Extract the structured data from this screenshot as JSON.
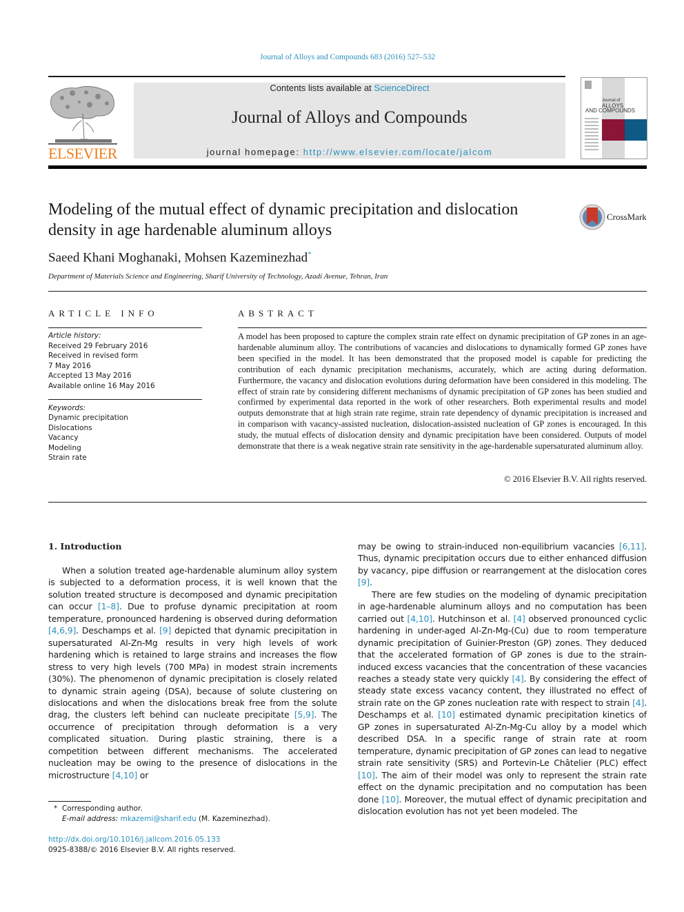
{
  "header": {
    "citation": "Journal of Alloys and Compounds 683 (2016) 527–532",
    "contents_prefix": "Contents lists available at ",
    "contents_link": "ScienceDirect",
    "journal_name": "Journal of Alloys and Compounds",
    "homepage_prefix": "journal homepage: ",
    "homepage_link": "http://www.elsevier.com/locate/jalcom",
    "publisher_logo_text": "ELSEVIER",
    "cover": {
      "line1": "Journal of",
      "line2": "ALLOYS",
      "line3": "AND COMPOUNDS",
      "accent_red": "#8a1537",
      "accent_blue": "#0d5a86"
    }
  },
  "article": {
    "title": "Modeling of the mutual effect of dynamic precipitation and dislocation density in age hardenable aluminum alloys",
    "authors": "Saeed Khani Moghanaki, Mohsen Kazeminezhad",
    "author_mark": "*",
    "affiliation": "Department of Materials Science and Engineering, Sharif University of Technology, Azadi Avenue, Tehran, Iran",
    "crossmark_label": "CrossMark"
  },
  "article_info": {
    "heading": "ARTICLE INFO",
    "history_label": "Article history:",
    "history": [
      "Received 29 February 2016",
      "Received in revised form",
      "7 May 2016",
      "Accepted 13 May 2016",
      "Available online 16 May 2016"
    ],
    "keywords_label": "Keywords:",
    "keywords": [
      "Dynamic precipitation",
      "Dislocations",
      "Vacancy",
      "Modeling",
      "Strain rate"
    ]
  },
  "abstract": {
    "heading": "ABSTRACT",
    "text": "A model has been proposed to capture the complex strain rate effect on dynamic precipitation of GP zones in an age-hardenable aluminum alloy. The contributions of vacancies and dislocations to dynamically formed GP zones have been specified in the model. It has been demonstrated that the proposed model is capable for predicting the contribution of each dynamic precipitation mechanisms, accurately, which are acting during deformation. Furthermore, the vacancy and dislocation evolutions during deformation have been considered in this modeling. The effect of strain rate by considering different mechanisms of dynamic precipitation of GP zones has been studied and confirmed by experimental data reported in the work of other researchers. Both experimental results and model outputs demonstrate that at high strain rate regime, strain rate dependency of dynamic precipitation is increased and in comparison with vacancy-assisted nucleation, dislocation-assisted nucleation of GP zones is encouraged. In this study, the mutual effects of dislocation density and dynamic precipitation have been considered. Outputs of model demonstrate that there is a weak negative strain rate sensitivity in the age-hardenable supersaturated aluminum alloy.",
    "copyright": "© 2016 Elsevier B.V. All rights reserved."
  },
  "body": {
    "section_heading": "1.  Introduction",
    "left": [
      {
        "t": "When a solution treated age-hardenable aluminum alloy system is subjected to a deformation process, it is well known that the solution treated structure is decomposed and dynamic precipitation can occur "
      },
      {
        "ref": "[1–8]"
      },
      {
        "t": ". Due to profuse dynamic precipitation at room temperature, pronounced hardening is observed during deformation "
      },
      {
        "ref": "[4,6,9]"
      },
      {
        "t": ". Deschamps et al. "
      },
      {
        "ref": "[9]"
      },
      {
        "t": " depicted that dynamic precipitation in supersaturated Al-Zn-Mg results in very high levels of work hardening which is retained to large strains and increases the flow stress to very high levels (700 MPa) in modest strain increments (30%). The phenomenon of dynamic precipitation is closely related to dynamic strain ageing (DSA), because of solute clustering on dislocations and when the dislocations break free from the solute drag, the clusters left behind can nucleate precipitate "
      },
      {
        "ref": "[5,9]"
      },
      {
        "t": ". The occurrence of precipitation through deformation is a very complicated situation. During plastic straining, there is a competition between different mechanisms. The accelerated nucleation may be owing to the presence of dislocations in the microstructure "
      },
      {
        "ref": "[4,10]"
      },
      {
        "t": " or"
      }
    ],
    "right_p1": [
      {
        "t": "may be owing to strain-induced non-equilibrium vacancies "
      },
      {
        "ref": "[6,11]"
      },
      {
        "t": ". Thus, dynamic precipitation occurs due to either enhanced diffusion by vacancy, pipe diffusion or rearrangement at the dislocation cores "
      },
      {
        "ref": "[9]"
      },
      {
        "t": "."
      }
    ],
    "right_p2": [
      {
        "t": "There are few studies on the modeling of dynamic precipitation in age-hardenable aluminum alloys and no computation has been carried out "
      },
      {
        "ref": "[4,10]"
      },
      {
        "t": ". Hutchinson et al. "
      },
      {
        "ref": "[4]"
      },
      {
        "t": " observed pronounced cyclic hardening in under-aged Al-Zn-Mg-(Cu) due to room temperature dynamic precipitation of Guinier-Preston (GP) zones. They deduced that the accelerated formation of GP zones is due to the strain-induced excess vacancies that the concentration of these vacancies reaches a steady state very quickly "
      },
      {
        "ref": "[4]"
      },
      {
        "t": ". By considering the effect of steady state excess vacancy content, they illustrated no effect of strain rate on the GP zones nucleation rate with respect to strain "
      },
      {
        "ref": "[4]"
      },
      {
        "t": ". Deschamps et al. "
      },
      {
        "ref": "[10]"
      },
      {
        "t": " estimated dynamic precipitation kinetics of GP zones in supersaturated Al-Zn-Mg-Cu alloy by a model which described DSA. In a specific range of strain rate at room temperature, dynamic precipitation of GP zones can lead to negative strain rate sensitivity (SRS) and Portevin-Le Châtelier (PLC) effect "
      },
      {
        "ref": "[10]"
      },
      {
        "t": ". The aim of their model was only to represent the strain rate effect on the dynamic precipitation and no computation has been done "
      },
      {
        "ref": "[10]"
      },
      {
        "t": ". Moreover, the mutual effect of dynamic precipitation and dislocation evolution has not yet been modeled. The"
      }
    ]
  },
  "footnote": {
    "mark": "*",
    "corresponding": "Corresponding author.",
    "email_label": "E-mail address: ",
    "email": "mkazemi@sharif.edu",
    "email_suffix": " (M. Kazeminezhad)."
  },
  "footer": {
    "doi": "http://dx.doi.org/10.1016/j.jallcom.2016.05.133",
    "issn_copyright": "0925-8388/© 2016 Elsevier B.V. All rights reserved."
  },
  "colors": {
    "link": "#2a8fbd",
    "elsevier_orange": "#f07d1a",
    "banner_gray": "#e6e6e6"
  }
}
